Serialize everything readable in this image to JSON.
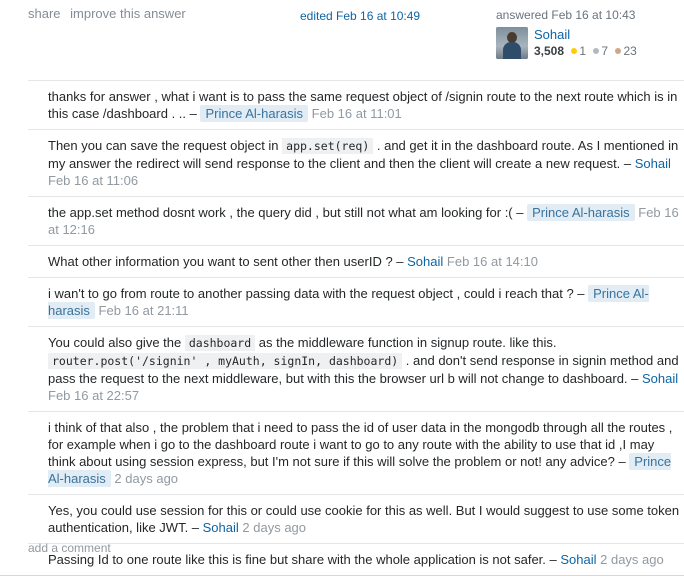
{
  "post_menu": {
    "share": "share",
    "improve": "improve this answer"
  },
  "edited": "edited Feb 16 at 10:49",
  "user_card": {
    "action_time": "answered Feb 16 at 10:43",
    "name": "Sohail",
    "reputation": "3,508",
    "gold": "1",
    "silver": "7",
    "bronze": "23",
    "badge_colors": {
      "gold": "#ffcc01",
      "silver": "#b4b8bc",
      "bronze": "#d1a684"
    }
  },
  "comments": [
    {
      "pre": "thanks for answer , what i want is to pass the same request object of /signin route to the next route which is in this case /dashboard . .. ",
      "sep": "– ",
      "author": "Prince Al-harasis",
      "date": "Feb 16 at 11:01"
    },
    {
      "pre": "Then you can save the request object in ",
      "code1": "app.set(req)",
      "mid": " . and get it in the dashboard route. As I mentioned in my answer the redirect will send response to the client and then the client will create a new request. ",
      "sep": "– ",
      "author": "Sohail",
      "date": "Feb 16 at 11:06"
    },
    {
      "pre": "the app.set method dosnt work , the query did , but still not what am looking for :( ",
      "sep": "– ",
      "author": "Prince Al-harasis",
      "date": "Feb 16 at 12:16"
    },
    {
      "pre": "What other information you want to sent other then userID ? ",
      "sep": "– ",
      "author": "Sohail",
      "date": "Feb 16 at 14:10"
    },
    {
      "pre": "i wan't to go from route to another passing data with the request object , could i reach that ? ",
      "sep": "– ",
      "author": "Prince Al-harasis",
      "date": "Feb 16 at 21:11"
    },
    {
      "pre": "You could also give the ",
      "code1": "dashboard",
      "mid": " as the middleware function in signup route. like this. ",
      "code2": "router.post('/signin' , myAuth, signIn, dashboard)",
      "post": " . and don't send response in signin method and pass the request to the next middleware, but with this the browser url b will not change to dashboard. ",
      "sep": "– ",
      "author": "Sohail",
      "date": "Feb 16 at 22:57"
    },
    {
      "pre": "i think of that also , the problem that i need to pass the id of user data in the mongodb through all the routes , for example when i go to the dashboard route i want to go to any route with the ability to use that id ,I may think about using session express, but I'm not sure if this will solve the problem or not! any advice? ",
      "sep": "– ",
      "author": "Prince Al-harasis",
      "date": "2 days ago"
    },
    {
      "pre": "Yes, you could use session for this or could use cookie for this as well. But I would suggest to use some token authentication, like JWT. ",
      "sep": "– ",
      "author": "Sohail",
      "date": "2 days ago"
    },
    {
      "pre": "Passing Id to one route like this is fine but share with the whole application is not safer. ",
      "sep": "– ",
      "author": "Sohail",
      "date": "2 days ago"
    }
  ],
  "add_comment": "add a comment"
}
